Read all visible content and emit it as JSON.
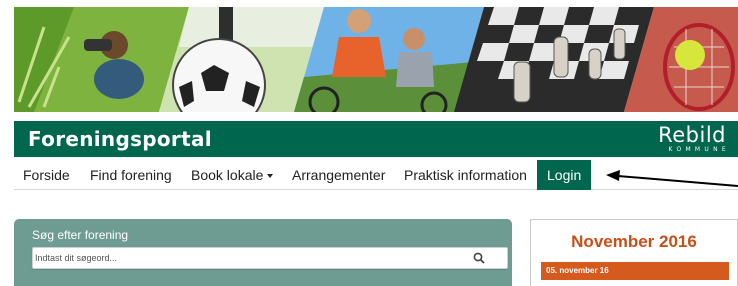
{
  "header": {
    "portal_title": "Foreningsportal",
    "logo": {
      "name": "Rebild",
      "sub": "KOMMUNE"
    }
  },
  "nav": {
    "items": [
      {
        "label": "Forside"
      },
      {
        "label": "Find forening"
      },
      {
        "label": "Book lokale",
        "has_dropdown": true
      },
      {
        "label": "Arrangementer"
      },
      {
        "label": "Praktisk information"
      },
      {
        "label": "Login"
      }
    ]
  },
  "search": {
    "label": "Søg efter forening",
    "placeholder": "Indtast dit søgeord..."
  },
  "calendar": {
    "month": "November 2016",
    "date": "05. november 16"
  },
  "colors": {
    "brand_green": "#00664d",
    "search_panel": "#6e9c93",
    "accent_orange": "#c94f17",
    "date_bar": "#d55a1e"
  }
}
